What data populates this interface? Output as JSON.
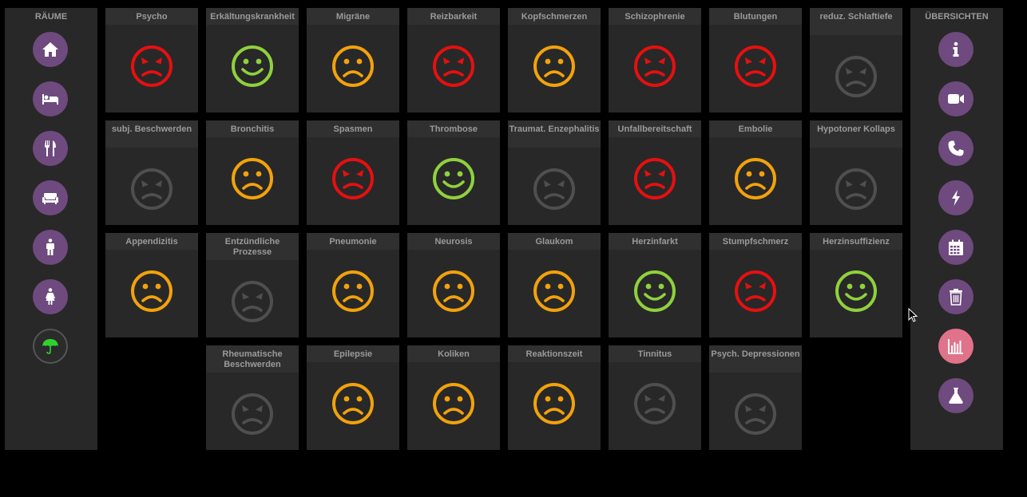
{
  "colors": {
    "red": "#e51010",
    "green": "#8fd13d",
    "orange": "#f2a20c",
    "gray": "#4f4f4f",
    "button_purple": "#6e4a7e",
    "button_pink": "#e0738a"
  },
  "left_panel": {
    "title": "RÄUME",
    "buttons": [
      {
        "icon": "home-icon"
      },
      {
        "icon": "bed-icon"
      },
      {
        "icon": "cutlery-icon"
      },
      {
        "icon": "sofa-icon"
      },
      {
        "icon": "man-icon"
      },
      {
        "icon": "woman-icon"
      },
      {
        "icon": "umbrella-icon"
      }
    ]
  },
  "right_panel": {
    "title": "ÜBERSICHTEN",
    "buttons": [
      {
        "icon": "info-icon"
      },
      {
        "icon": "video-camera-icon"
      },
      {
        "icon": "phone-icon"
      },
      {
        "icon": "lightning-icon"
      },
      {
        "icon": "calendar-icon"
      },
      {
        "icon": "trash-icon"
      },
      {
        "icon": "bar-chart-icon"
      },
      {
        "icon": "flask-icon"
      }
    ]
  },
  "tiles": [
    {
      "label": "Psycho",
      "mood": "angry"
    },
    {
      "label": "Erkältungskrankheit",
      "mood": "happy"
    },
    {
      "label": "Migräne",
      "mood": "sad"
    },
    {
      "label": "Reizbarkeit",
      "mood": "angry"
    },
    {
      "label": "Kopfschmerzen",
      "mood": "sad"
    },
    {
      "label": "Schizophrenie",
      "mood": "angry"
    },
    {
      "label": "Blutungen",
      "mood": "angry"
    },
    {
      "label": "reduz. Schlaftiefe",
      "mood": "inactive"
    },
    {
      "label": "subj. Beschwerden",
      "mood": "inactive"
    },
    {
      "label": "Bronchitis",
      "mood": "sad"
    },
    {
      "label": "Spasmen",
      "mood": "angry"
    },
    {
      "label": "Thrombose",
      "mood": "happy"
    },
    {
      "label": "Traumat. Enzephalitis",
      "mood": "inactive"
    },
    {
      "label": "Unfallbereitschaft",
      "mood": "angry"
    },
    {
      "label": "Embolie",
      "mood": "sad"
    },
    {
      "label": "Hypotoner Kollaps",
      "mood": "inactive"
    },
    {
      "label": "Appendizitis",
      "mood": "sad"
    },
    {
      "label": "Entzündliche Prozesse",
      "mood": "inactive"
    },
    {
      "label": "Pneumonie",
      "mood": "sad"
    },
    {
      "label": "Neurosis",
      "mood": "sad"
    },
    {
      "label": "Glaukom",
      "mood": "sad"
    },
    {
      "label": "Herzinfarkt",
      "mood": "happy"
    },
    {
      "label": "Stumpfschmerz",
      "mood": "angry"
    },
    {
      "label": "Herzinsuffizienz",
      "mood": "happy"
    },
    {
      "label": "Rheumatische Beschwerden",
      "mood": "inactive"
    },
    {
      "label": "Epilepsie",
      "mood": "sad"
    },
    {
      "label": "Koliken",
      "mood": "sad"
    },
    {
      "label": "Reaktionszeit",
      "mood": "sad"
    },
    {
      "label": "Tinnitus",
      "mood": "inactive"
    },
    {
      "label": "Psych. Depressionen",
      "mood": "inactive"
    }
  ]
}
